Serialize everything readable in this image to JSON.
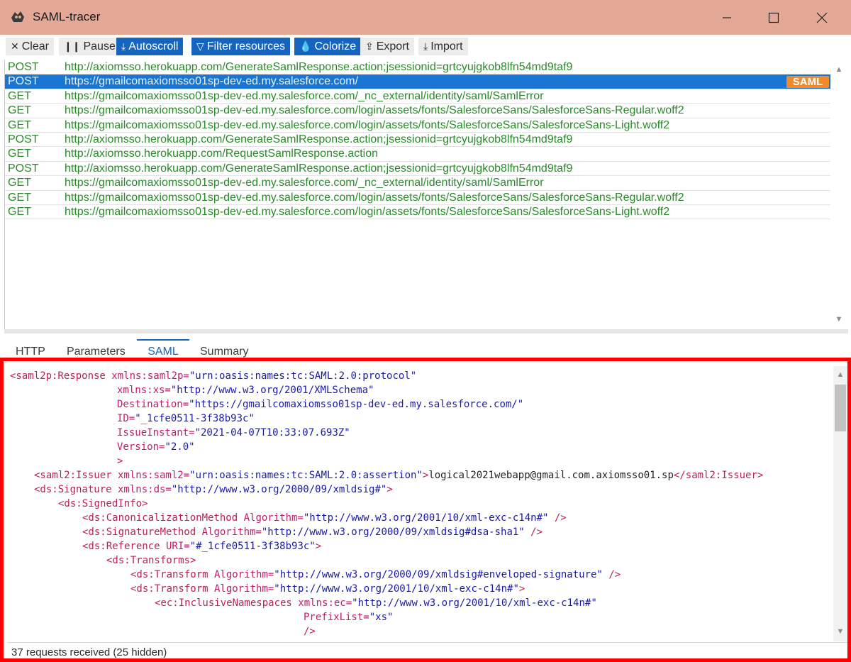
{
  "window": {
    "title": "SAML-tracer"
  },
  "toolbar": {
    "clear": "Clear",
    "pause": "Pause",
    "autoscroll": "Autoscroll",
    "filter": "Filter resources",
    "colorize": "Colorize",
    "export": "Export",
    "import": "Import"
  },
  "requests": [
    {
      "method": "POST",
      "url": "http://axiomsso.herokuapp.com/GenerateSamlResponse.action;jsessionid=grtcyujgkob8lfn54md9taf9"
    },
    {
      "method": "POST",
      "url": "https://gmailcomaxiomsso01sp-dev-ed.my.salesforce.com/",
      "badge": "SAML"
    },
    {
      "method": "GET",
      "url": "https://gmailcomaxiomsso01sp-dev-ed.my.salesforce.com/_nc_external/identity/saml/SamlError"
    },
    {
      "method": "GET",
      "url": "https://gmailcomaxiomsso01sp-dev-ed.my.salesforce.com/login/assets/fonts/SalesforceSans/SalesforceSans-Regular.woff2"
    },
    {
      "method": "GET",
      "url": "https://gmailcomaxiomsso01sp-dev-ed.my.salesforce.com/login/assets/fonts/SalesforceSans/SalesforceSans-Light.woff2"
    },
    {
      "method": "POST",
      "url": "http://axiomsso.herokuapp.com/GenerateSamlResponse.action;jsessionid=grtcyujgkob8lfn54md9taf9"
    },
    {
      "method": "GET",
      "url": "http://axiomsso.herokuapp.com/RequestSamlResponse.action"
    },
    {
      "method": "POST",
      "url": "http://axiomsso.herokuapp.com/GenerateSamlResponse.action;jsessionid=grtcyujgkob8lfn54md9taf9"
    },
    {
      "method": "GET",
      "url": "https://gmailcomaxiomsso01sp-dev-ed.my.salesforce.com/_nc_external/identity/saml/SamlError"
    },
    {
      "method": "GET",
      "url": "https://gmailcomaxiomsso01sp-dev-ed.my.salesforce.com/login/assets/fonts/SalesforceSans/SalesforceSans-Regular.woff2"
    },
    {
      "method": "GET",
      "url": "https://gmailcomaxiomsso01sp-dev-ed.my.salesforce.com/login/assets/fonts/SalesforceSans/SalesforceSans-Light.woff2"
    }
  ],
  "tabs": {
    "http": "HTTP",
    "parameters": "Parameters",
    "saml": "SAML",
    "summary": "Summary"
  },
  "saml_xml": {
    "l01": {
      "tag": "<saml2p:Response",
      "attr": " xmlns:saml2p=",
      "val": "\"urn:oasis:names:tc:SAML:2.0:protocol\""
    },
    "l02": {
      "attr": "xmlns:xs=",
      "val": "\"http://www.w3.org/2001/XMLSchema\""
    },
    "l03": {
      "attr": "Destination=",
      "val": "\"https://gmailcomaxiomsso01sp-dev-ed.my.salesforce.com/\""
    },
    "l04": {
      "attr": "ID=",
      "val": "\"_1cfe0511-3f38b93c\""
    },
    "l05": {
      "attr": "IssueInstant=",
      "val": "\"2021-04-07T10:33:07.693Z\""
    },
    "l06": {
      "attr": "Version=",
      "val": "\"2.0\""
    },
    "l07": {
      "tag": ">"
    },
    "l08": {
      "tag": "<saml2:Issuer",
      "attr": " xmlns:saml2=",
      "val": "\"urn:oasis:names:tc:SAML:2.0:assertion\"",
      "tag2": ">",
      "text": "logical2021webapp@gmail.com.axiomsso01.sp",
      "close": "</saml2:Issuer>"
    },
    "l09": {
      "tag": "<ds:Signature",
      "attr": " xmlns:ds=",
      "val": "\"http://www.w3.org/2000/09/xmldsig#\"",
      "tag2": ">"
    },
    "l10": {
      "tag": "<ds:SignedInfo>"
    },
    "l11": {
      "tag": "<ds:CanonicalizationMethod",
      "attr": " Algorithm=",
      "val": "\"http://www.w3.org/2001/10/xml-exc-c14n#\"",
      "tag2": " />"
    },
    "l12": {
      "tag": "<ds:SignatureMethod",
      "attr": " Algorithm=",
      "val": "\"http://www.w3.org/2000/09/xmldsig#dsa-sha1\"",
      "tag2": " />"
    },
    "l13": {
      "tag": "<ds:Reference",
      "attr": " URI=",
      "val": "\"#_1cfe0511-3f38b93c\"",
      "tag2": ">"
    },
    "l14": {
      "tag": "<ds:Transforms>"
    },
    "l15": {
      "tag": "<ds:Transform",
      "attr": " Algorithm=",
      "val": "\"http://www.w3.org/2000/09/xmldsig#enveloped-signature\"",
      "tag2": " />"
    },
    "l16": {
      "tag": "<ds:Transform",
      "attr": " Algorithm=",
      "val": "\"http://www.w3.org/2001/10/xml-exc-c14n#\"",
      "tag2": ">"
    },
    "l17": {
      "tag": "<ec:InclusiveNamespaces",
      "attr": " xmlns:ec=",
      "val": "\"http://www.w3.org/2001/10/xml-exc-c14n#\""
    },
    "l18": {
      "attr": "PrefixList=",
      "val": "\"xs\""
    },
    "l19": {
      "tag": "/>"
    }
  },
  "status": {
    "text": "37 requests received (25 hidden)"
  }
}
